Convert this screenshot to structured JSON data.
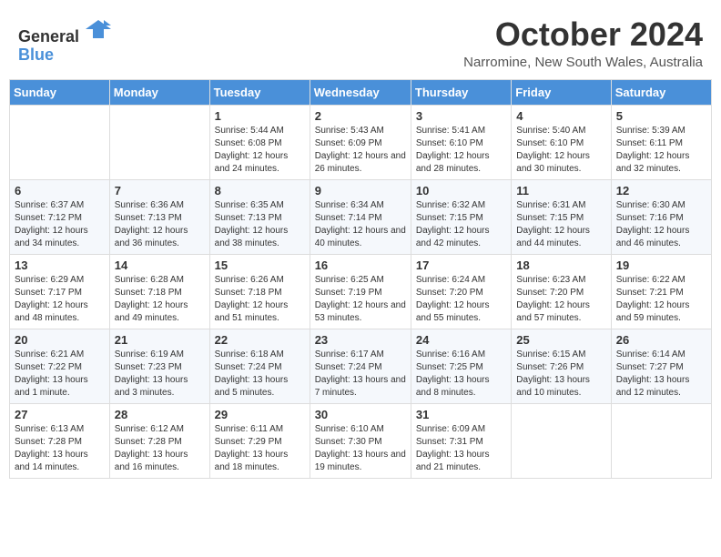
{
  "logo": {
    "general": "General",
    "blue": "Blue"
  },
  "header": {
    "month": "October 2024",
    "location": "Narromine, New South Wales, Australia"
  },
  "days_of_week": [
    "Sunday",
    "Monday",
    "Tuesday",
    "Wednesday",
    "Thursday",
    "Friday",
    "Saturday"
  ],
  "weeks": [
    [
      {
        "day": "",
        "info": ""
      },
      {
        "day": "",
        "info": ""
      },
      {
        "day": "1",
        "info": "Sunrise: 5:44 AM\nSunset: 6:08 PM\nDaylight: 12 hours and 24 minutes."
      },
      {
        "day": "2",
        "info": "Sunrise: 5:43 AM\nSunset: 6:09 PM\nDaylight: 12 hours and 26 minutes."
      },
      {
        "day": "3",
        "info": "Sunrise: 5:41 AM\nSunset: 6:10 PM\nDaylight: 12 hours and 28 minutes."
      },
      {
        "day": "4",
        "info": "Sunrise: 5:40 AM\nSunset: 6:10 PM\nDaylight: 12 hours and 30 minutes."
      },
      {
        "day": "5",
        "info": "Sunrise: 5:39 AM\nSunset: 6:11 PM\nDaylight: 12 hours and 32 minutes."
      }
    ],
    [
      {
        "day": "6",
        "info": "Sunrise: 6:37 AM\nSunset: 7:12 PM\nDaylight: 12 hours and 34 minutes."
      },
      {
        "day": "7",
        "info": "Sunrise: 6:36 AM\nSunset: 7:13 PM\nDaylight: 12 hours and 36 minutes."
      },
      {
        "day": "8",
        "info": "Sunrise: 6:35 AM\nSunset: 7:13 PM\nDaylight: 12 hours and 38 minutes."
      },
      {
        "day": "9",
        "info": "Sunrise: 6:34 AM\nSunset: 7:14 PM\nDaylight: 12 hours and 40 minutes."
      },
      {
        "day": "10",
        "info": "Sunrise: 6:32 AM\nSunset: 7:15 PM\nDaylight: 12 hours and 42 minutes."
      },
      {
        "day": "11",
        "info": "Sunrise: 6:31 AM\nSunset: 7:15 PM\nDaylight: 12 hours and 44 minutes."
      },
      {
        "day": "12",
        "info": "Sunrise: 6:30 AM\nSunset: 7:16 PM\nDaylight: 12 hours and 46 minutes."
      }
    ],
    [
      {
        "day": "13",
        "info": "Sunrise: 6:29 AM\nSunset: 7:17 PM\nDaylight: 12 hours and 48 minutes."
      },
      {
        "day": "14",
        "info": "Sunrise: 6:28 AM\nSunset: 7:18 PM\nDaylight: 12 hours and 49 minutes."
      },
      {
        "day": "15",
        "info": "Sunrise: 6:26 AM\nSunset: 7:18 PM\nDaylight: 12 hours and 51 minutes."
      },
      {
        "day": "16",
        "info": "Sunrise: 6:25 AM\nSunset: 7:19 PM\nDaylight: 12 hours and 53 minutes."
      },
      {
        "day": "17",
        "info": "Sunrise: 6:24 AM\nSunset: 7:20 PM\nDaylight: 12 hours and 55 minutes."
      },
      {
        "day": "18",
        "info": "Sunrise: 6:23 AM\nSunset: 7:20 PM\nDaylight: 12 hours and 57 minutes."
      },
      {
        "day": "19",
        "info": "Sunrise: 6:22 AM\nSunset: 7:21 PM\nDaylight: 12 hours and 59 minutes."
      }
    ],
    [
      {
        "day": "20",
        "info": "Sunrise: 6:21 AM\nSunset: 7:22 PM\nDaylight: 13 hours and 1 minute."
      },
      {
        "day": "21",
        "info": "Sunrise: 6:19 AM\nSunset: 7:23 PM\nDaylight: 13 hours and 3 minutes."
      },
      {
        "day": "22",
        "info": "Sunrise: 6:18 AM\nSunset: 7:24 PM\nDaylight: 13 hours and 5 minutes."
      },
      {
        "day": "23",
        "info": "Sunrise: 6:17 AM\nSunset: 7:24 PM\nDaylight: 13 hours and 7 minutes."
      },
      {
        "day": "24",
        "info": "Sunrise: 6:16 AM\nSunset: 7:25 PM\nDaylight: 13 hours and 8 minutes."
      },
      {
        "day": "25",
        "info": "Sunrise: 6:15 AM\nSunset: 7:26 PM\nDaylight: 13 hours and 10 minutes."
      },
      {
        "day": "26",
        "info": "Sunrise: 6:14 AM\nSunset: 7:27 PM\nDaylight: 13 hours and 12 minutes."
      }
    ],
    [
      {
        "day": "27",
        "info": "Sunrise: 6:13 AM\nSunset: 7:28 PM\nDaylight: 13 hours and 14 minutes."
      },
      {
        "day": "28",
        "info": "Sunrise: 6:12 AM\nSunset: 7:28 PM\nDaylight: 13 hours and 16 minutes."
      },
      {
        "day": "29",
        "info": "Sunrise: 6:11 AM\nSunset: 7:29 PM\nDaylight: 13 hours and 18 minutes."
      },
      {
        "day": "30",
        "info": "Sunrise: 6:10 AM\nSunset: 7:30 PM\nDaylight: 13 hours and 19 minutes."
      },
      {
        "day": "31",
        "info": "Sunrise: 6:09 AM\nSunset: 7:31 PM\nDaylight: 13 hours and 21 minutes."
      },
      {
        "day": "",
        "info": ""
      },
      {
        "day": "",
        "info": ""
      }
    ]
  ]
}
